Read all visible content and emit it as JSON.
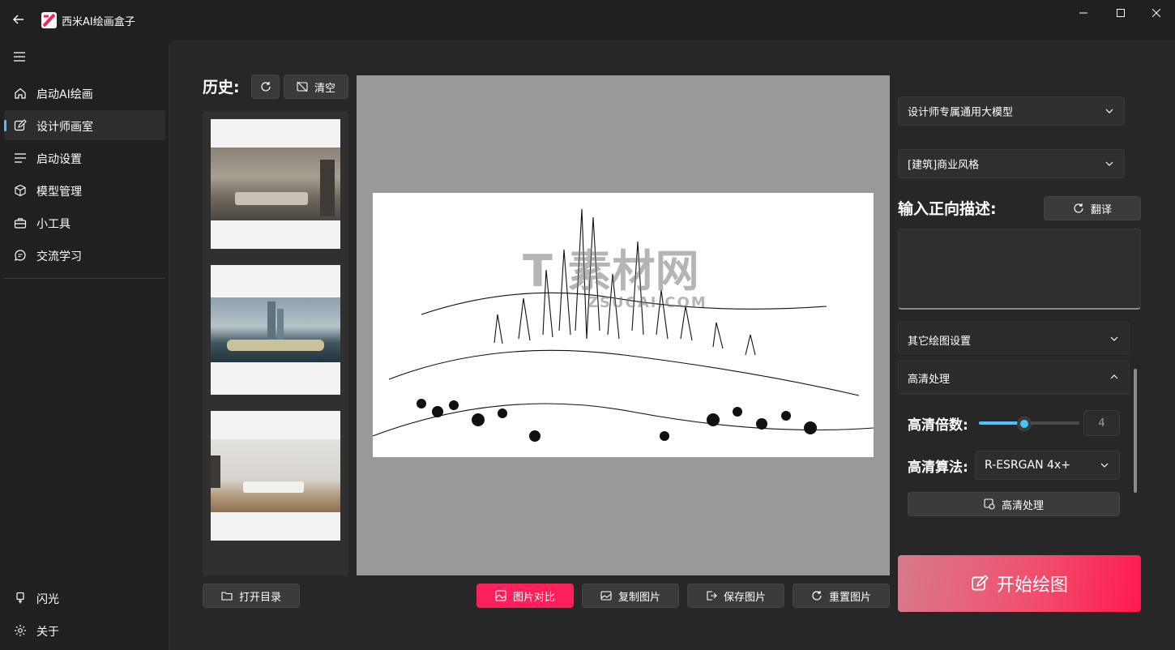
{
  "app": {
    "title": "西米AI绘画盒子"
  },
  "sidebar": {
    "items": [
      {
        "label": "启动AI绘画",
        "icon": "home-icon"
      },
      {
        "label": "设计师画室",
        "icon": "edit-icon",
        "active": true
      },
      {
        "label": "启动设置",
        "icon": "list-icon"
      },
      {
        "label": "模型管理",
        "icon": "cube-icon"
      },
      {
        "label": "小工具",
        "icon": "toolbox-icon"
      },
      {
        "label": "交流学习",
        "icon": "chat-icon"
      }
    ],
    "footer": [
      {
        "label": "闪光",
        "icon": "flash-icon"
      },
      {
        "label": "关于",
        "icon": "gear-icon"
      }
    ]
  },
  "history": {
    "title": "历史:",
    "clear_label": "清空",
    "open_dir_label": "打开目录"
  },
  "preview": {
    "watermark_main": "T 素材网",
    "watermark_sub": "ZSUCAI.COM"
  },
  "actions": {
    "compare_label": "图片对比",
    "copy_label": "复制图片",
    "save_label": "保存图片",
    "reset_label": "重置图片"
  },
  "right": {
    "model_select": "设计师专属通用大模型",
    "style_select": "[建筑]商业风格",
    "prompt_label": "输入正向描述:",
    "translate_label": "翻译",
    "prompt_value": "",
    "other_settings_title": "其它绘图设置",
    "hd_title": "高清处理",
    "hd_scale_label": "高清倍数:",
    "hd_scale_value": "4",
    "hd_scale_fraction": 0.45,
    "hd_algo_label": "高清算法:",
    "hd_algo_value": "R-ESRGAN 4x+",
    "hd_button_label": "高清处理",
    "start_label": "开始绘图"
  },
  "colors": {
    "accent": "#4cc2ff",
    "primary_red": "#ff1f5a",
    "background": "#202020",
    "panel": "#272727"
  }
}
